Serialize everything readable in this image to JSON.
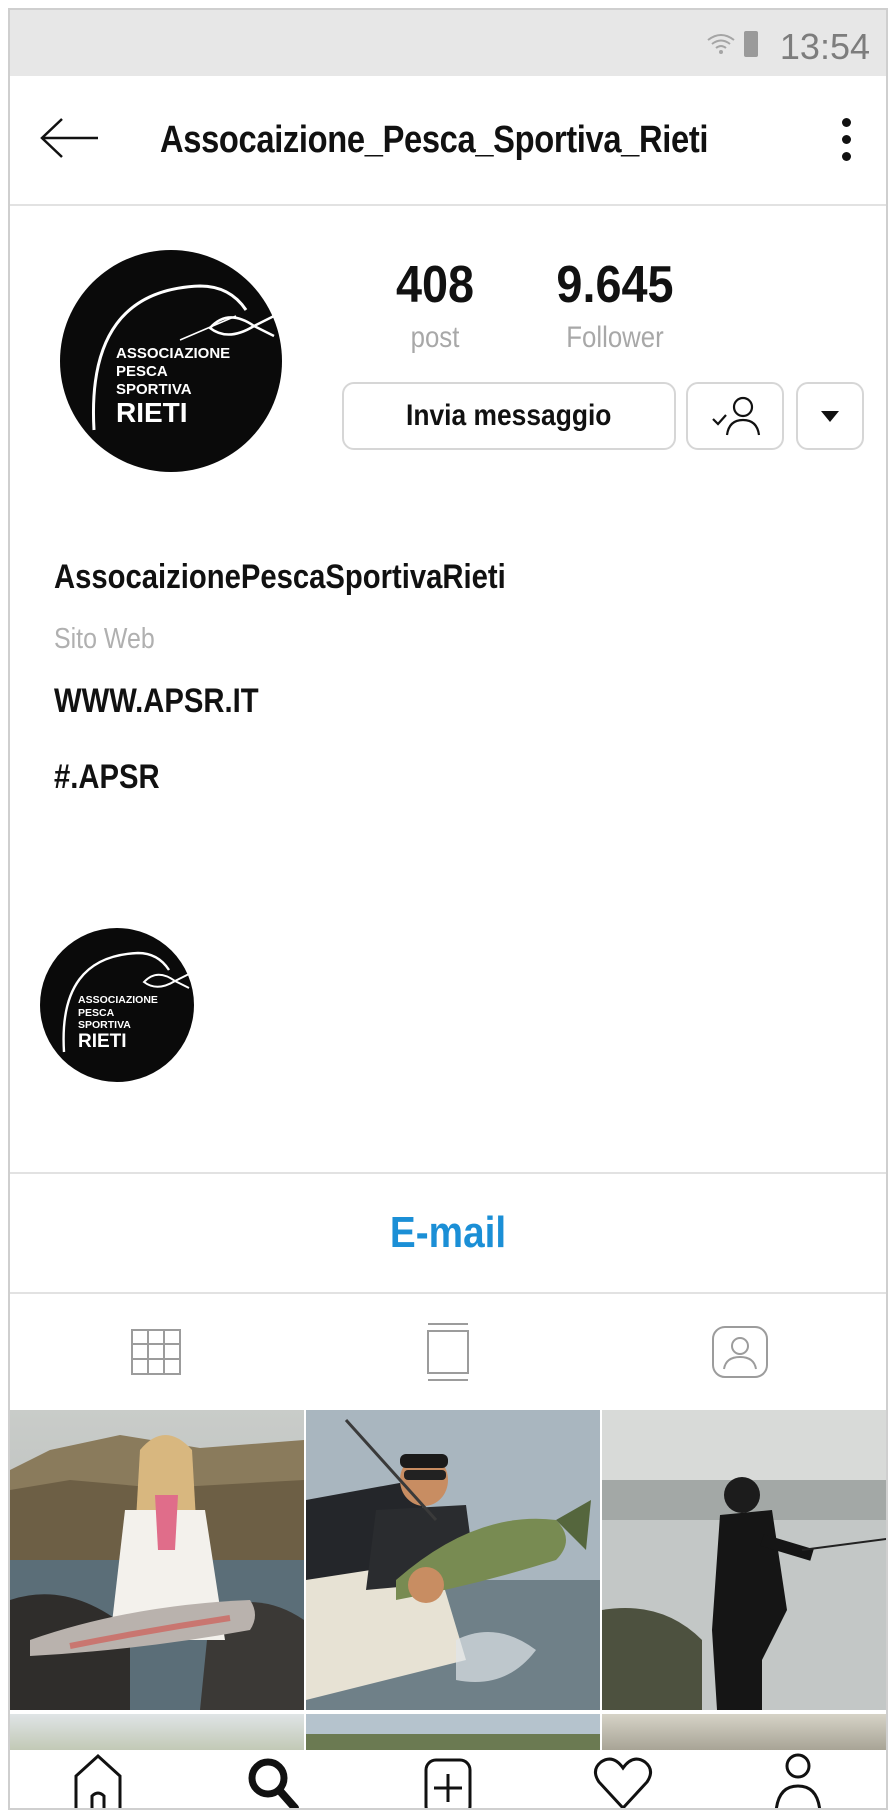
{
  "status_bar": {
    "time": "13:54"
  },
  "header": {
    "username": "Assocaizione_Pesca_Sportiva_Rieti"
  },
  "logo": {
    "line1": "ASSOCIAZIONE",
    "line2": "PESCA",
    "line3": "SPORTIVA",
    "line4": "RIETI"
  },
  "stats": {
    "posts": {
      "value": "408",
      "label": "post"
    },
    "followers": {
      "value": "9.645",
      "label": "Follower"
    }
  },
  "actions": {
    "message_label": "Invia messaggio"
  },
  "bio": {
    "name": "AssocaizionePescaSportivaRieti",
    "category": "Sito Web",
    "link": "WWW.APSR.IT",
    "hashtag": "#.APSR"
  },
  "contact": {
    "email_label": "E-mail"
  },
  "tabs": [
    {
      "icon": "grid-icon"
    },
    {
      "icon": "feed-icon"
    },
    {
      "icon": "tagged-icon"
    }
  ],
  "nav": [
    {
      "icon": "home-icon"
    },
    {
      "icon": "search-icon"
    },
    {
      "icon": "add-post-icon"
    },
    {
      "icon": "heart-icon"
    },
    {
      "icon": "profile-icon"
    }
  ],
  "colors": {
    "email_link": "#1b8fd6",
    "status_bar_bg": "#e7e7e7"
  }
}
